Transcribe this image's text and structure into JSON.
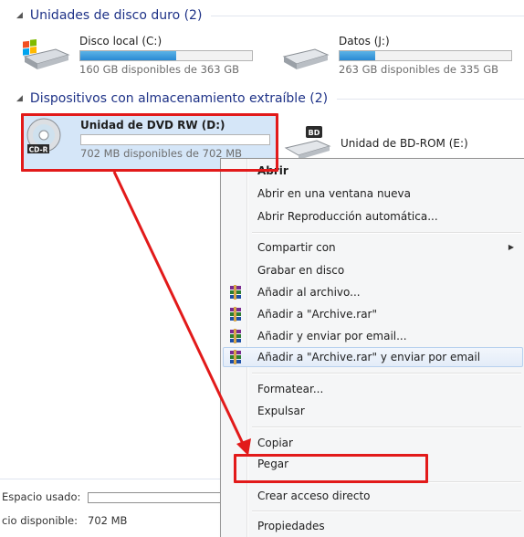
{
  "groups": {
    "hard_disks": {
      "title": "Unidades de disco duro (2)"
    },
    "removable": {
      "title": "Dispositivos con almacenamiento extraíble (2)"
    }
  },
  "drives": {
    "c": {
      "name": "Disco local (C:)",
      "free": "160 GB disponibles de 363 GB",
      "used_fraction": 0.56
    },
    "j": {
      "name": "Datos (J:)",
      "free": "263 GB disponibles de 335 GB",
      "used_fraction": 0.21
    },
    "d": {
      "name": "Unidad de DVD RW (D:)",
      "free": "702 MB disponibles de 702 MB",
      "used_fraction": 0.0,
      "badge": "CD-R"
    },
    "e": {
      "name": "Unidad de BD-ROM (E:)",
      "badge": "BD"
    }
  },
  "details": {
    "used_label": "Espacio usado:",
    "free_label": "cio disponible:",
    "free_value": "702 MB"
  },
  "context_menu": {
    "open": "Abrir",
    "open_new_window": "Abrir en una ventana nueva",
    "autoplay": "Abrir Reproducción automática...",
    "share_with": "Compartir con",
    "burn": "Grabar en disco",
    "add_archive": "Añadir al archivo...",
    "add_archive_rar": "Añadir a \"Archive.rar\"",
    "add_email": "Añadir y enviar por email...",
    "add_rar_email": "Añadir a \"Archive.rar\" y enviar por email",
    "format": "Formatear...",
    "eject": "Expulsar",
    "copy": "Copiar",
    "paste": "Pegar",
    "create_shortcut": "Crear acceso directo",
    "properties": "Propiedades"
  },
  "colors": {
    "annotation": "#e21a1a",
    "group_header": "#1e3287",
    "bar_fill": "#2a8ad4",
    "selection": "#d5e6f8"
  },
  "icons": {
    "hdd": "hard-drive-icon",
    "windows_hdd": "windows-drive-icon",
    "dvd": "cd-r-disc-icon",
    "bd": "bd-rom-drive-icon",
    "winrar": "winrar-icon"
  }
}
